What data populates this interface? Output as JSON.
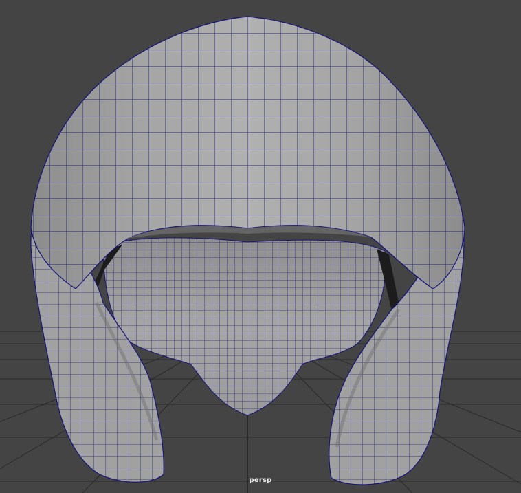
{
  "viewport": {
    "camera_label": "persp",
    "colors": {
      "background": "#444444",
      "grid": "#2a2a2a",
      "grid_axis": "#1d1d1d",
      "mesh_surface": "#a3a3a3",
      "mesh_surface_light": "#b4b4b4",
      "mesh_shadow": "#7a7a7a",
      "mesh_inner": "#9e9e9e",
      "mesh_hole": "#1c1c1c",
      "wireframe": "#16147a"
    },
    "object": "helmet-mesh"
  }
}
